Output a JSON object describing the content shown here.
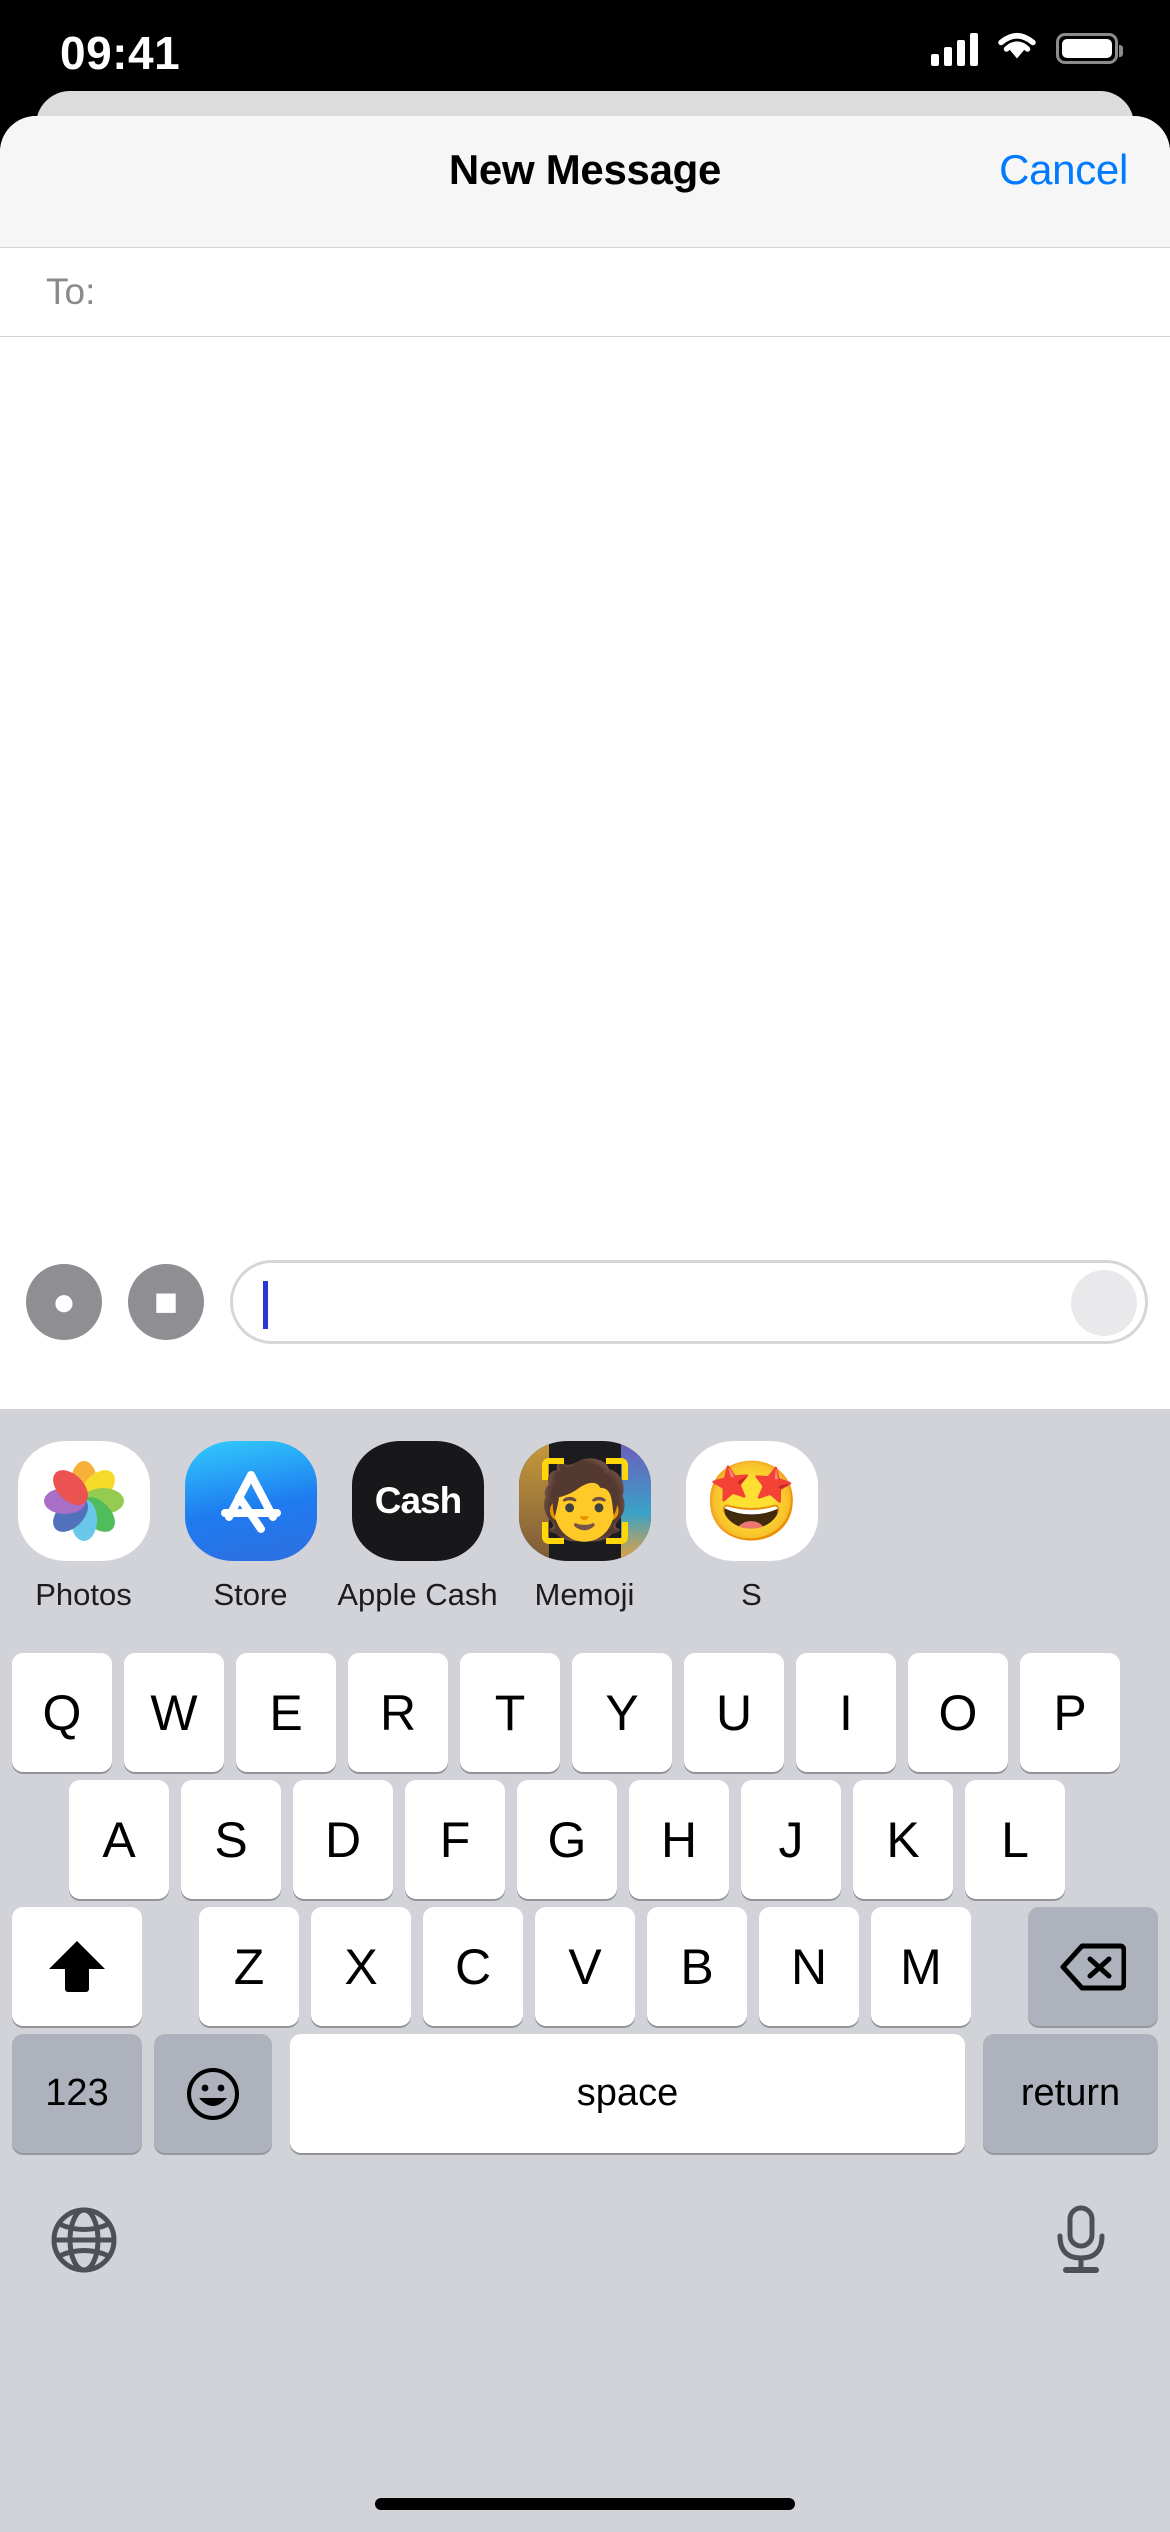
{
  "device": {
    "status_bar": {
      "time": "09:41",
      "cellular_icon": "cellular-signal-icon",
      "wifi_icon": "wifi-icon",
      "battery_icon": "battery-icon"
    },
    "home_indicator": "home-indicator"
  },
  "sheet": {
    "nav": {
      "title": "New Message",
      "cancel_label": "Cancel",
      "accent_color": "#007aff"
    },
    "to_field": {
      "label": "To:",
      "value": "",
      "placeholder": ""
    },
    "conversation": {
      "messages": []
    },
    "input_bar": {
      "camera_icon": "camera-icon",
      "apps_icon": "apps-grid-icon",
      "placeholder": "",
      "send_icon": "send-arrow-icon"
    }
  },
  "app_drawer": {
    "apps": [
      {
        "label": "Photos",
        "icon": "photos-icon"
      },
      {
        "label": "Store",
        "icon": "app-store-icon"
      },
      {
        "label": "Apple Cash",
        "icon": "apple-cash-icon",
        "wordmark": "Cash",
        "apple_glyph": ""
      },
      {
        "label": "Memoji",
        "icon": "memoji-icon",
        "face": "🧑"
      },
      {
        "label": "S",
        "icon": "stickers-icon",
        "face": "🤩"
      }
    ]
  },
  "keyboard": {
    "row1": [
      "Q",
      "W",
      "E",
      "R",
      "T",
      "Y",
      "U",
      "I",
      "O",
      "P"
    ],
    "row2": [
      "A",
      "S",
      "D",
      "F",
      "G",
      "H",
      "J",
      "K",
      "L"
    ],
    "row3_letters": [
      "Z",
      "X",
      "C",
      "V",
      "B",
      "N",
      "M"
    ],
    "shift_icon": "shift-arrow-icon",
    "delete_icon": "delete-backspace-icon",
    "numbers_label": "123",
    "emoji_icon": "emoji-smiley-icon",
    "space_label": "space",
    "return_label": "return",
    "globe_icon": "globe-icon",
    "dictation_icon": "microphone-icon",
    "background_color": "#d1d3d9",
    "key_color": "#ffffff",
    "modifier_key_color": "#adb2bc"
  }
}
